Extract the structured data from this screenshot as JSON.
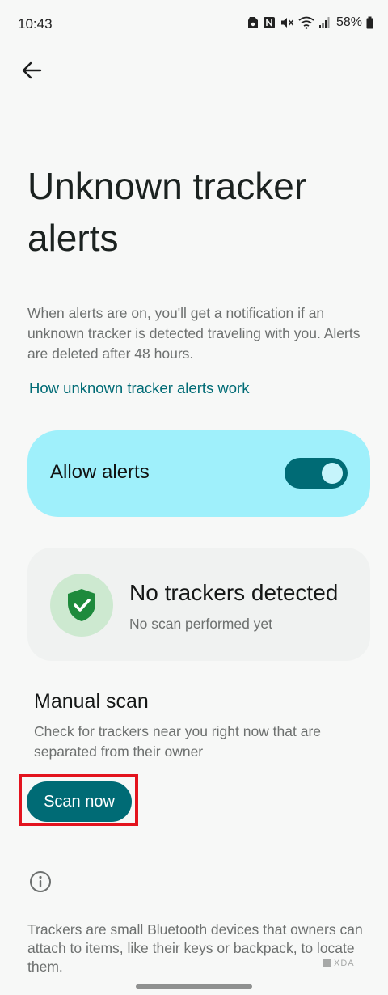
{
  "status_bar": {
    "time": "10:43",
    "battery": "58%",
    "icons": [
      "save-icon",
      "nfc-icon",
      "mute-icon",
      "wifi-icon",
      "signal-icon",
      "battery-icon"
    ]
  },
  "header": {
    "back_icon": "arrow-left-icon"
  },
  "page": {
    "title": "Unknown tracker alerts",
    "description": "When alerts are on, you'll get a notification if an unknown tracker is detected traveling with you. Alerts are deleted after 48 hours.",
    "help_link": "How unknown tracker alerts work"
  },
  "allow_alerts": {
    "label": "Allow alerts",
    "enabled": true
  },
  "tracker_status": {
    "title": "No trackers detected",
    "subtitle": "No scan performed yet",
    "icon": "shield-check-icon"
  },
  "manual_scan": {
    "title": "Manual scan",
    "description": "Check for trackers near you right now that are separated from their owner",
    "button_label": "Scan now"
  },
  "info": {
    "icon": "info-icon",
    "text": "Trackers are small Bluetooth devices that owners can attach to items, like their keys or backpack, to locate them."
  },
  "watermark": {
    "text": "XDA"
  },
  "colors": {
    "accent": "#006b75",
    "card_highlight": "#9ff0fb",
    "shield_green": "#1e8a3c",
    "annotation_red": "#e3131e",
    "background": "#f7f8f7"
  }
}
